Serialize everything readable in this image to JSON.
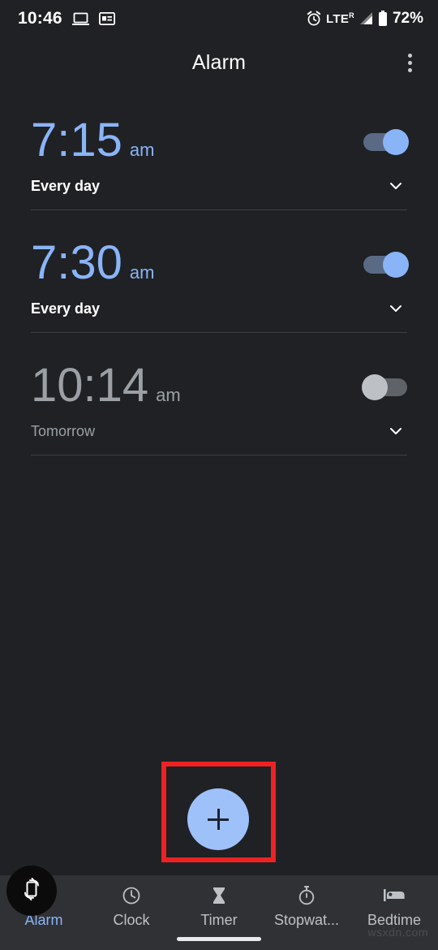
{
  "status_bar": {
    "time": "10:46",
    "left_icons": [
      "laptop-icon",
      "news-card-icon"
    ],
    "alarm_icon": "alarm-clock-icon",
    "network": "LTE",
    "network_sup": "R",
    "signal_icon": "signal-bars-icon",
    "battery_icon": "battery-icon",
    "battery_percent": "72%"
  },
  "app_bar": {
    "title": "Alarm",
    "overflow_icon": "more-vertical-icon"
  },
  "alarms": [
    {
      "time": "7:15",
      "ampm": "am",
      "schedule": "Every day",
      "enabled": true,
      "time_color": "#8ab4f8"
    },
    {
      "time": "7:30",
      "ampm": "am",
      "schedule": "Every day",
      "enabled": true,
      "time_color": "#8ab4f8"
    },
    {
      "time": "10:14",
      "ampm": "am",
      "schedule": "Tomorrow",
      "enabled": false,
      "time_color": "#9aa0a6"
    }
  ],
  "fab": {
    "icon": "plus-icon",
    "label": "Add alarm",
    "color": "#9ec1fa",
    "highlight_color": "#ee2222"
  },
  "bottom_nav": {
    "items": [
      {
        "label": "Alarm",
        "icon": "alarm-icon",
        "active": true
      },
      {
        "label": "Clock",
        "icon": "clock-icon",
        "active": false
      },
      {
        "label": "Timer",
        "icon": "hourglass-icon",
        "active": false
      },
      {
        "label": "Stopwat...",
        "icon": "stopwatch-icon",
        "active": false
      },
      {
        "label": "Bedtime",
        "icon": "bed-icon",
        "active": false
      }
    ],
    "active_color": "#8ab4f8",
    "inactive_color": "#bdc1c6"
  },
  "rotate_button": {
    "icon": "screen-rotation-icon"
  },
  "watermark": {
    "text": "wsxdn.com"
  }
}
